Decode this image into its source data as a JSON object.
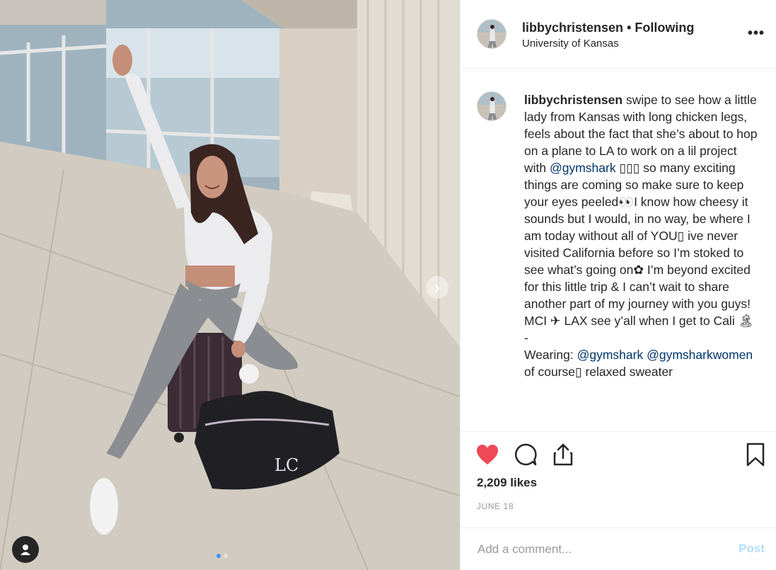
{
  "post": {
    "username": "libbychristensen",
    "separator": "•",
    "follow_status": "Following",
    "location": "University of Kansas",
    "more_options": "•••"
  },
  "caption": {
    "username": "libbychristensen",
    "p1": " swipe to see how a little lady from Kansas with long chicken legs, feels about the fact that she’s about to hop on a plane to LA to work on a lil project with ",
    "mention1": "@gymshark",
    "p2": " ▯▯▯ so many exciting things are coming so make sure to keep your eyes peeled👀I know how cheesy it sounds but I would, in no way, be where I am today without all of YOU▯ ive never visited California before so I’m stoked to see what’s going on✿ I’m beyond excited for this little trip & I can’t wait to share another part of my journey with you guys! MCI ✈ LAX see y’all when I get to Cali 🏝",
    "dash": "-",
    "p3": "Wearing: ",
    "mention2": "@gymshark",
    "mention3": "@gymsharkwomen",
    "p4": " of course▯ relaxed sweater"
  },
  "stats": {
    "likes": "2,209 likes",
    "date": "JUNE 18",
    "liked": true
  },
  "comment": {
    "placeholder": "Add a comment...",
    "post_label": "Post"
  },
  "carousel": {
    "total": 2,
    "current": 1
  },
  "colors": {
    "like": "#ed4956",
    "mention": "#003569",
    "post_disabled": "#b2dffc",
    "meta": "#999999"
  },
  "icons": [
    "heart-icon",
    "comment-icon",
    "share-icon",
    "bookmark-icon",
    "chevron-right-icon",
    "user-tag-icon"
  ]
}
